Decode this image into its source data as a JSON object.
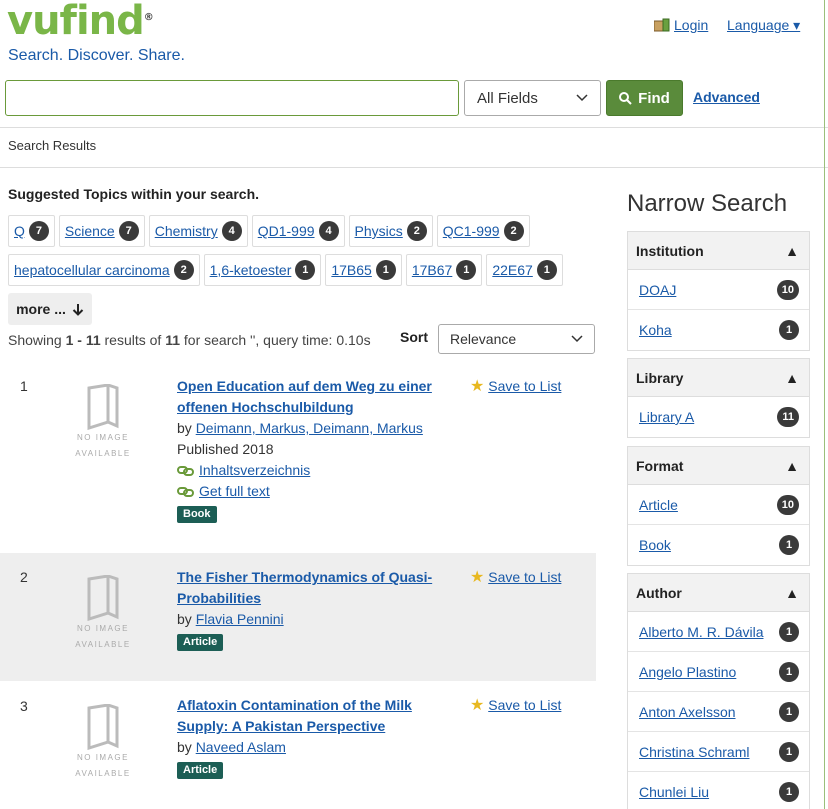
{
  "header": {
    "logo_text": "vufind",
    "logo_reg": "®",
    "tagline": "Search. Discover. Share.",
    "login_label": "Login",
    "language_label": "Language ▾"
  },
  "search": {
    "value": "",
    "field_selected": "All Fields",
    "find_label": "Find",
    "advanced_label": "Advanced"
  },
  "breadcrumb": "Search Results",
  "suggested": {
    "title": "Suggested Topics within your search.",
    "row1": [
      {
        "label": "Q",
        "count": "7"
      },
      {
        "label": "Science",
        "count": "7"
      },
      {
        "label": "Chemistry",
        "count": "4"
      },
      {
        "label": "QD1-999",
        "count": "4"
      },
      {
        "label": "Physics",
        "count": "2"
      },
      {
        "label": "QC1-999",
        "count": "2"
      }
    ],
    "row2": [
      {
        "label": "hepatocellular carcinoma",
        "count": "2"
      },
      {
        "label": "1,6-ketoester",
        "count": "1"
      },
      {
        "label": "17B65",
        "count": "1"
      },
      {
        "label": "17B67",
        "count": "1"
      },
      {
        "label": "22E67",
        "count": "1"
      }
    ],
    "more_label": "more ..."
  },
  "results_info": {
    "prefix": "Showing ",
    "range": "1 - 11",
    "mid": " results of ",
    "total": "11",
    "suffix": " for search '', query time: 0.10s",
    "sort_label": "Sort",
    "sort_selected": "Relevance"
  },
  "results": [
    {
      "num": "1",
      "title": "Open Education auf dem Weg zu einer offenen Hochschulbildung",
      "by": "by ",
      "authors": "Deimann, Markus, Deimann, Markus",
      "published": "Published 2018",
      "links": [
        "Inhaltsverzeichnis",
        "Get full text"
      ],
      "format": "Book",
      "save_label": "Save to List",
      "noimage": "NO IMAGE AVAILABLE"
    },
    {
      "num": "2",
      "title": "The Fisher Thermodynamics of Quasi-Probabilities",
      "by": "by ",
      "authors": "Flavia Pennini",
      "format": "Article",
      "save_label": "Save to List",
      "noimage": "NO IMAGE AVAILABLE"
    },
    {
      "num": "3",
      "title": "Aflatoxin Contamination of the Milk Supply: A Pakistan Perspective",
      "by": "by ",
      "authors": "Naveed Aslam",
      "format": "Article",
      "save_label": "Save to List",
      "noimage": "NO IMAGE AVAILABLE"
    }
  ],
  "narrow": {
    "title": "Narrow Search",
    "facets": [
      {
        "name": "Institution",
        "items": [
          {
            "label": "DOAJ",
            "count": "10"
          },
          {
            "label": "Koha",
            "count": "1"
          }
        ]
      },
      {
        "name": "Library",
        "items": [
          {
            "label": "Library A",
            "count": "11"
          }
        ]
      },
      {
        "name": "Format",
        "items": [
          {
            "label": "Article",
            "count": "10"
          },
          {
            "label": "Book",
            "count": "1"
          }
        ]
      },
      {
        "name": "Author",
        "items": [
          {
            "label": "Alberto M. R. Dávila",
            "count": "1"
          },
          {
            "label": "Angelo Plastino",
            "count": "1"
          },
          {
            "label": "Anton Axelsson",
            "count": "1"
          },
          {
            "label": "Christina Schraml",
            "count": "1"
          },
          {
            "label": "Chunlei Liu",
            "count": "1"
          }
        ]
      }
    ]
  },
  "colors": {
    "brand_green": "#7ab648",
    "link_blue": "#1a5aa8",
    "find_green": "#5a8b3b",
    "format_teal": "#1c5e55"
  }
}
